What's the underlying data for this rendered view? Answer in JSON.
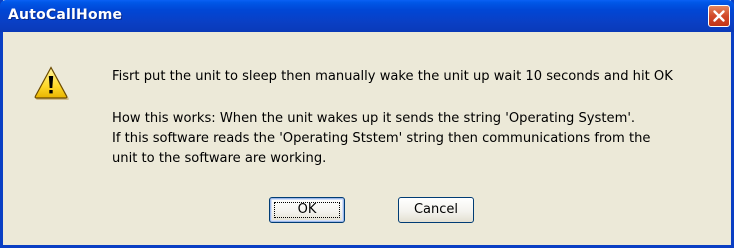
{
  "window": {
    "title": "AutoCallHome",
    "close_icon": "close-icon",
    "colors": {
      "titlebar": "#0a3fc4",
      "dialog_bg": "#ece9d8",
      "close_button": "#d24a2a"
    }
  },
  "dialog": {
    "icon": "warning-icon",
    "message": "Fisrt put the unit to sleep then manually wake the unit up wait 10 seconds and hit OK",
    "explanation": [
      "How this works:  When the unit wakes up it sends the string 'Operating System'.",
      "If this software reads the 'Operating Ststem' string then communications from the",
      "unit to the software are working."
    ]
  },
  "buttons": {
    "ok_label": "OK",
    "cancel_label": "Cancel"
  }
}
